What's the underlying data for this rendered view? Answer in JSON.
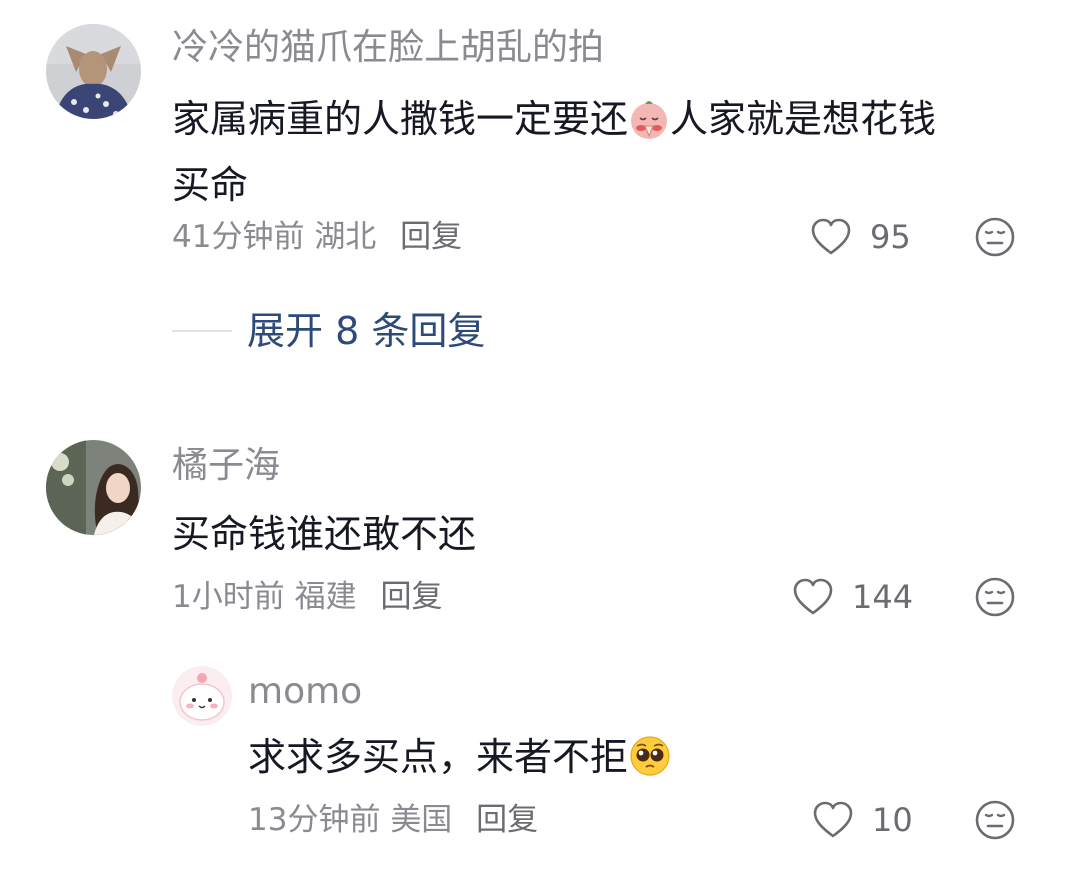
{
  "comments": [
    {
      "username": "冷冷的猫爪在脸上胡乱的拍",
      "text_part1": "家属病重的人撒钱一定要还",
      "text_part2": "人家就是想花钱",
      "text_line2": "买命",
      "time": "41分钟前",
      "location": "湖北",
      "reply_label": "回复",
      "likes": "95"
    },
    {
      "username": "橘子海",
      "text": "买命钱谁还敢不还",
      "time": "1小时前",
      "location": "福建",
      "reply_label": "回复",
      "likes": "144"
    }
  ],
  "expand_replies": "展开 8 条回复",
  "sub_reply": {
    "username": "momo",
    "text": "求求多买点，来者不拒",
    "time": "13分钟前",
    "location": "美国",
    "reply_label": "回复",
    "likes": "10"
  },
  "icons": {
    "like": "heart-outline-icon",
    "dislike": "neutral-face-icon",
    "emoji_1": "praying-pig-emoji",
    "emoji_2": "pleading-face-emoji"
  },
  "colors": {
    "text": "#161823",
    "meta": "#8a8b91",
    "link": "#2e4a78"
  }
}
